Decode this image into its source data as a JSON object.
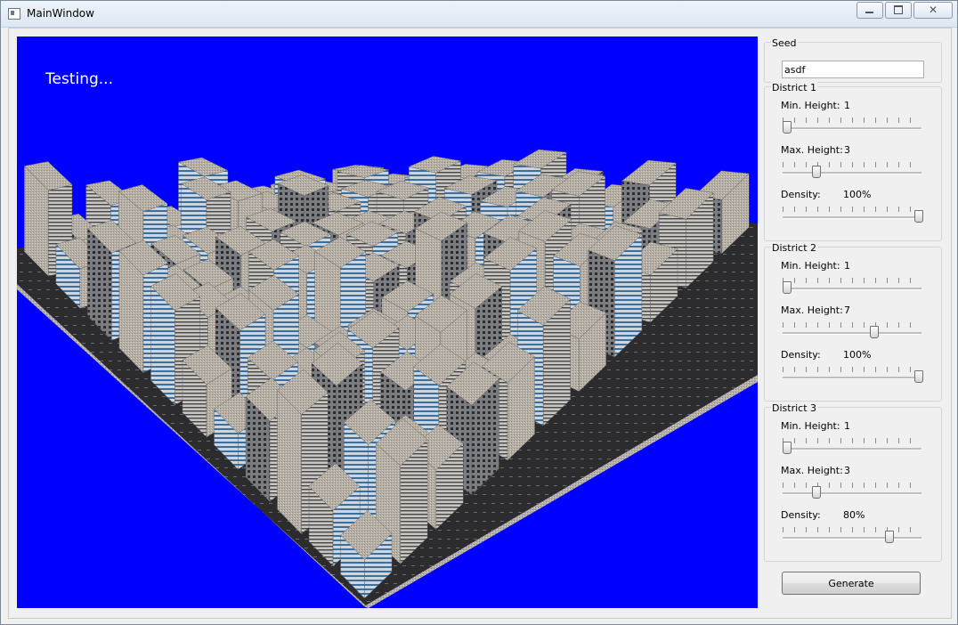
{
  "window": {
    "title": "MainWindow",
    "minimize_icon": "minimize-icon",
    "maximize_icon": "maximize-icon",
    "close_icon": "close-icon",
    "close_glyph": "✕"
  },
  "viewport": {
    "overlay_text": "Testing...",
    "background": "#0000ff"
  },
  "seed": {
    "label": "Seed",
    "value": "asdf"
  },
  "districts": [
    {
      "title": "District 1",
      "min_height": {
        "label": "Min. Height:",
        "value": "1",
        "level": 0.0
      },
      "max_height": {
        "label": "Max. Height:",
        "value": "3",
        "level": 0.22
      },
      "density": {
        "label": "Density:",
        "value": "100%",
        "level": 1.0
      }
    },
    {
      "title": "District 2",
      "min_height": {
        "label": "Min. Height:",
        "value": "1",
        "level": 0.0
      },
      "max_height": {
        "label": "Max. Height:",
        "value": "7",
        "level": 0.66
      },
      "density": {
        "label": "Density:",
        "value": "100%",
        "level": 1.0
      }
    },
    {
      "title": "District 3",
      "min_height": {
        "label": "Min. Height:",
        "value": "1",
        "level": 0.0
      },
      "max_height": {
        "label": "Max. Height:",
        "value": "3",
        "level": 0.22
      },
      "density": {
        "label": "Density:",
        "value": "80%",
        "level": 0.78
      }
    }
  ],
  "generate_button": {
    "label": "Generate"
  }
}
